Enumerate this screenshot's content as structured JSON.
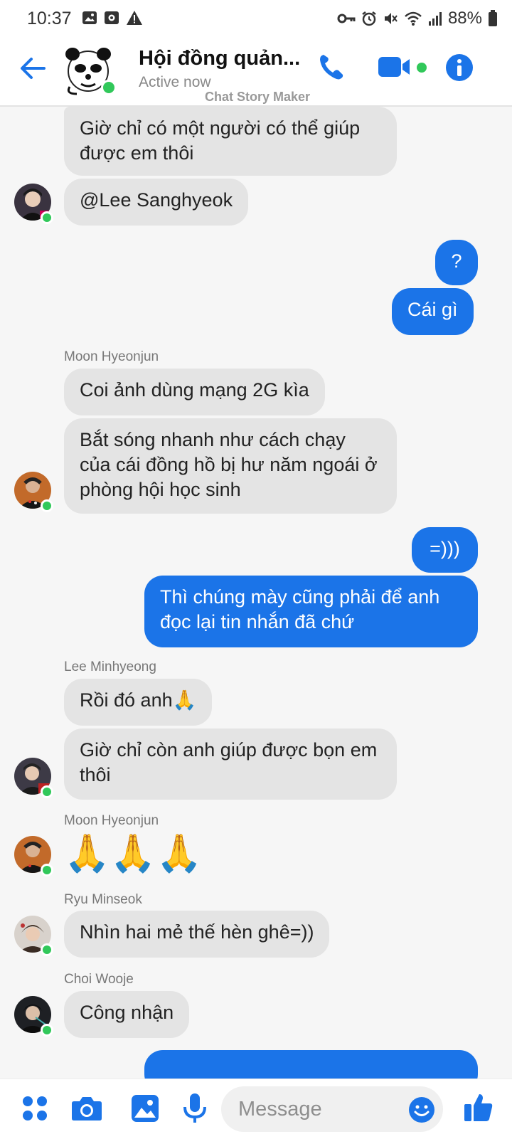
{
  "status_bar": {
    "time": "10:37",
    "battery": "88%"
  },
  "header": {
    "title": "Hội đồng quản...",
    "status": "Active now",
    "watermark": "Chat Story Maker"
  },
  "messages": {
    "m1": "Giờ chỉ có một người có thể giúp được em thôi",
    "m2": "@Lee Sanghyeok",
    "m3": "?",
    "m4": "Cái gì",
    "sender1": "Moon Hyeonjun",
    "m5": "Coi ảnh dùng mạng 2G kìa",
    "m6": "Bắt sóng nhanh như cách chạy của cái đồng hồ bị hư năm ngoái ở phòng hội học sinh",
    "m7": "=)))",
    "m8": "Thì chúng mày cũng phải để anh đọc lại tin nhắn đã chứ",
    "sender2": "Lee Minhyeong",
    "m9": "Rồi đó anh🙏",
    "m10": "Giờ chỉ còn anh giúp được bọn em thôi",
    "sender3": "Moon Hyeonjun",
    "m11": "🙏🙏🙏",
    "sender4": "Ryu Minseok",
    "m12": "Nhìn hai mẻ thế hèn ghê=))",
    "sender5": "Choi Wooje",
    "m13": "Công nhận"
  },
  "composer": {
    "placeholder": "Message"
  },
  "colors": {
    "accent": "#1b74e8",
    "incoming": "#e4e4e4",
    "online": "#31c85a"
  }
}
